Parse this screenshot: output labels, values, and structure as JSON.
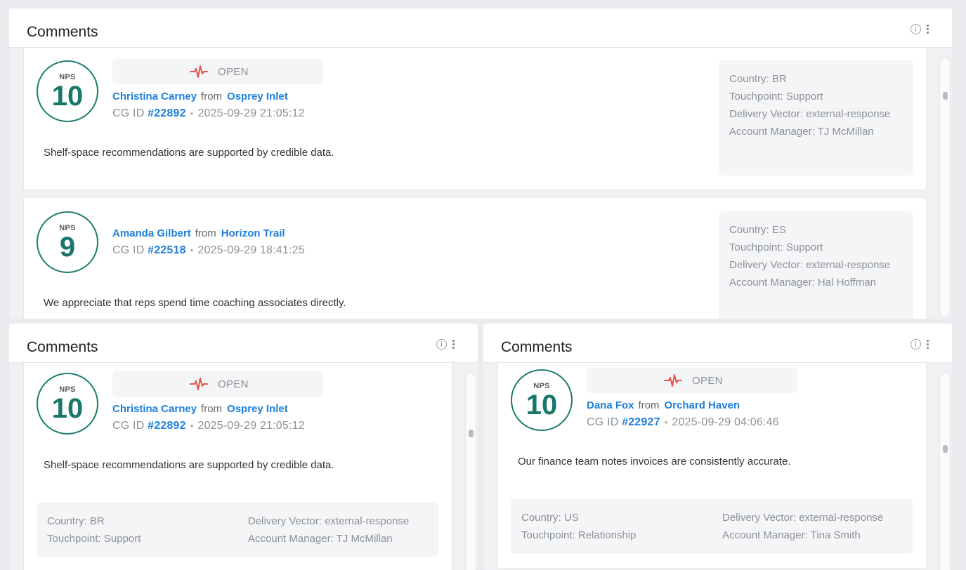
{
  "panels": {
    "top": {
      "title": "Comments",
      "cards": [
        {
          "nps_label": "NPS",
          "score": "10",
          "status": "OPEN",
          "name": "Christina Carney",
          "from": "from",
          "company": "Osprey Inlet",
          "cg_prefix": "CG ID",
          "cg_id": "#22892",
          "timestamp": "2025-09-29 21:05:12",
          "comment": "Shelf-space recommendations are supported by credible data.",
          "meta": {
            "country": "Country: BR",
            "touchpoint": "Touchpoint: Support",
            "vector": "Delivery Vector: external-response",
            "manager": "Account Manager: TJ McMillan"
          }
        },
        {
          "nps_label": "NPS",
          "score": "9",
          "name": "Amanda Gilbert",
          "from": "from",
          "company": "Horizon Trail",
          "cg_prefix": "CG ID",
          "cg_id": "#22518",
          "timestamp": "2025-09-29 18:41:25",
          "comment": "We appreciate that reps spend time coaching associates directly.",
          "meta": {
            "country": "Country: ES",
            "touchpoint": "Touchpoint: Support",
            "vector": "Delivery Vector: external-response",
            "manager": "Account Manager: Hal Hoffman"
          }
        }
      ]
    },
    "left": {
      "title": "Comments",
      "card": {
        "nps_label": "NPS",
        "score": "10",
        "status": "OPEN",
        "name": "Christina Carney",
        "from": "from",
        "company": "Osprey Inlet",
        "cg_prefix": "CG ID",
        "cg_id": "#22892",
        "timestamp": "2025-09-29 21:05:12",
        "comment": "Shelf-space recommendations are supported by credible data.",
        "meta": {
          "country": "Country: BR",
          "touchpoint": "Touchpoint: Support",
          "vector": "Delivery Vector: external-response",
          "manager": "Account Manager: TJ McMillan"
        }
      }
    },
    "right": {
      "title": "Comments",
      "card": {
        "nps_label": "NPS",
        "score": "10",
        "status": "OPEN",
        "name": "Dana Fox",
        "from": "from",
        "company": "Orchard Haven",
        "cg_prefix": "CG ID",
        "cg_id": "#22927",
        "timestamp": "2025-09-29 04:06:46",
        "comment": "Our finance team notes invoices are consistently accurate.",
        "meta": {
          "country": "Country: US",
          "touchpoint": "Touchpoint: Relationship",
          "vector": "Delivery Vector: external-response",
          "manager": "Account Manager: Tina Smith"
        }
      }
    }
  },
  "icons": {
    "info": "info-icon",
    "menu": "kebab-menu-icon",
    "status": "pulse-icon"
  },
  "colors": {
    "nps_ring": "#1a7d6e",
    "link": "#1e7fd8",
    "pulse": "#e0524d",
    "muted": "#8c9197"
  }
}
